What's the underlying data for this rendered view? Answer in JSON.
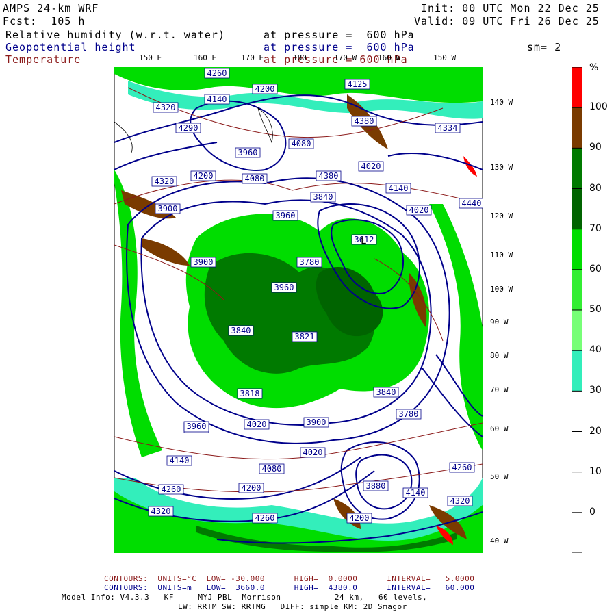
{
  "header": {
    "model": "AMPS 24-km WRF",
    "fcst": "Fcst:  105 h",
    "init": "Init: 00 UTC Mon 22 Dec 25",
    "valid": "Valid: 09 UTC Fri 26 Dec 25",
    "rh_label": "Relative humidity (w.r.t. water)",
    "rh_level": "at pressure =  600 hPa",
    "gph_label": "Geopotential height",
    "gph_level": "at pressure =  600 hPa",
    "temp_label": "Temperature",
    "temp_level": "at pressure = 600 hPa",
    "smooth": "sm= 2"
  },
  "lon_top": [
    "150 E",
    "160 E",
    "170 E",
    "180",
    "170 W",
    "160 W",
    "150 W"
  ],
  "lat_right": [
    "140 W",
    "130 W",
    "120 W",
    "110 W",
    "100 W",
    "90 W",
    "80 W",
    "70 W",
    "60 W",
    "50 W",
    "40 W"
  ],
  "colorbar": {
    "unit": "%",
    "ticks": [
      "100",
      "90",
      "80",
      "70",
      "60",
      "50",
      "40",
      "30",
      "20",
      "10",
      "0"
    ],
    "colors": [
      "#ff0000",
      "#7a3b00",
      "#007a00",
      "#006400",
      "#00dd00",
      "#33ee33",
      "#77ff77",
      "#33eebb",
      "#ffffff",
      "#ffffff",
      "#ffffff",
      "#ffffff"
    ]
  },
  "map": {
    "height_labels": [
      "4260",
      "4200",
      "4140",
      "4320",
      "4290",
      "4125",
      "4080",
      "4380",
      "4334",
      "3960",
      "4200",
      "4380",
      "4080",
      "4320",
      "4020",
      "4140",
      "4440",
      "3840",
      "3900",
      "4020",
      "3960",
      "3612",
      "3780",
      "3900",
      "3960",
      "3840",
      "3821",
      "3818",
      "3960",
      "4020",
      "3900",
      "3840",
      "3780",
      "4020",
      "4080",
      "3960",
      "4140",
      "4260",
      "4200",
      "4320",
      "4260",
      "4200",
      "4140",
      "3880",
      "4260",
      "4320"
    ],
    "colors": {
      "rh_high": "#007a00",
      "rh_mid": "#00dd00",
      "rh_teal": "#33eebb",
      "rh_brown": "#7a3b00",
      "rh_red": "#ff0000",
      "gph": "#00008b",
      "temp": "#8b1a1a"
    }
  },
  "footer": {
    "temp_contours": "CONTOURS:  UNITS=°C  LOW= -30.000      HIGH=  0.0000      INTERVAL=   5.0000",
    "gph_contours": "CONTOURS:  UNITS=m   LOW=  3660.0      HIGH=  4380.0      INTERVAL=   60.000",
    "model_info": "Model Info: V4.3.3   KF     MYJ PBL  Morrison           24 km,   60 levels,",
    "model_info2": "LW: RRTM SW: RRTMG   DIFF: simple KM: 2D Smagor"
  }
}
